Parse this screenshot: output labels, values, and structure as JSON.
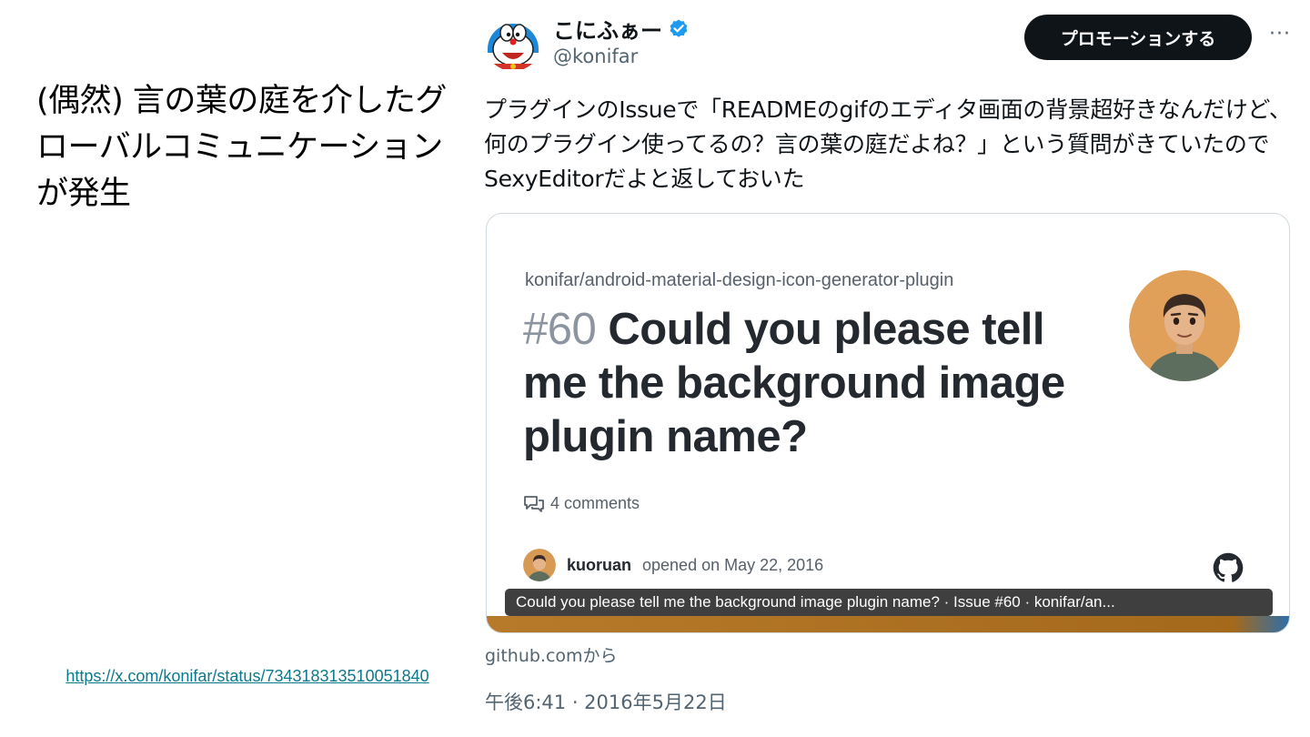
{
  "slide": {
    "heading": "(偶然) 言の葉の庭を介したグローバルコミュニケーションが発生",
    "source_link": "https://x.com/konifar/status/734318313510051840"
  },
  "tweet": {
    "display_name": "こにふぁー",
    "handle": "@konifar",
    "promote_label": "プロモーションする",
    "more_label": "···",
    "text": "プラグインのIssueで「READMEのgifのエディタ画面の背景超好きなんだけど、何のプラグイン使ってるの？言の葉の庭だよね？」という質問がきていたのでSexyEditorだよと返しておいた",
    "timestamp": "午後6:41 · 2016年5月22日",
    "icons": {
      "avatar": "doraemon-avatar",
      "verified": "verified-badge-icon",
      "more": "more-icon"
    },
    "colors": {
      "verified": "#1d9bf0",
      "promote_bg": "#0f1419"
    }
  },
  "card": {
    "repo_path": "konifar/android-material-design-icon-generator-plugin",
    "issue_number": "#60",
    "issue_title": "Could you please tell me the background image plugin name?",
    "comments": "4 comments",
    "opener_name": "kuoruan",
    "opened_text": "opened on May 22, 2016",
    "caption": "Could you please tell me the background image plugin name? · Issue #60 · konifar/an...",
    "domain": "github.comから",
    "icons": {
      "comments": "comment-icon",
      "github": "github-icon"
    }
  }
}
